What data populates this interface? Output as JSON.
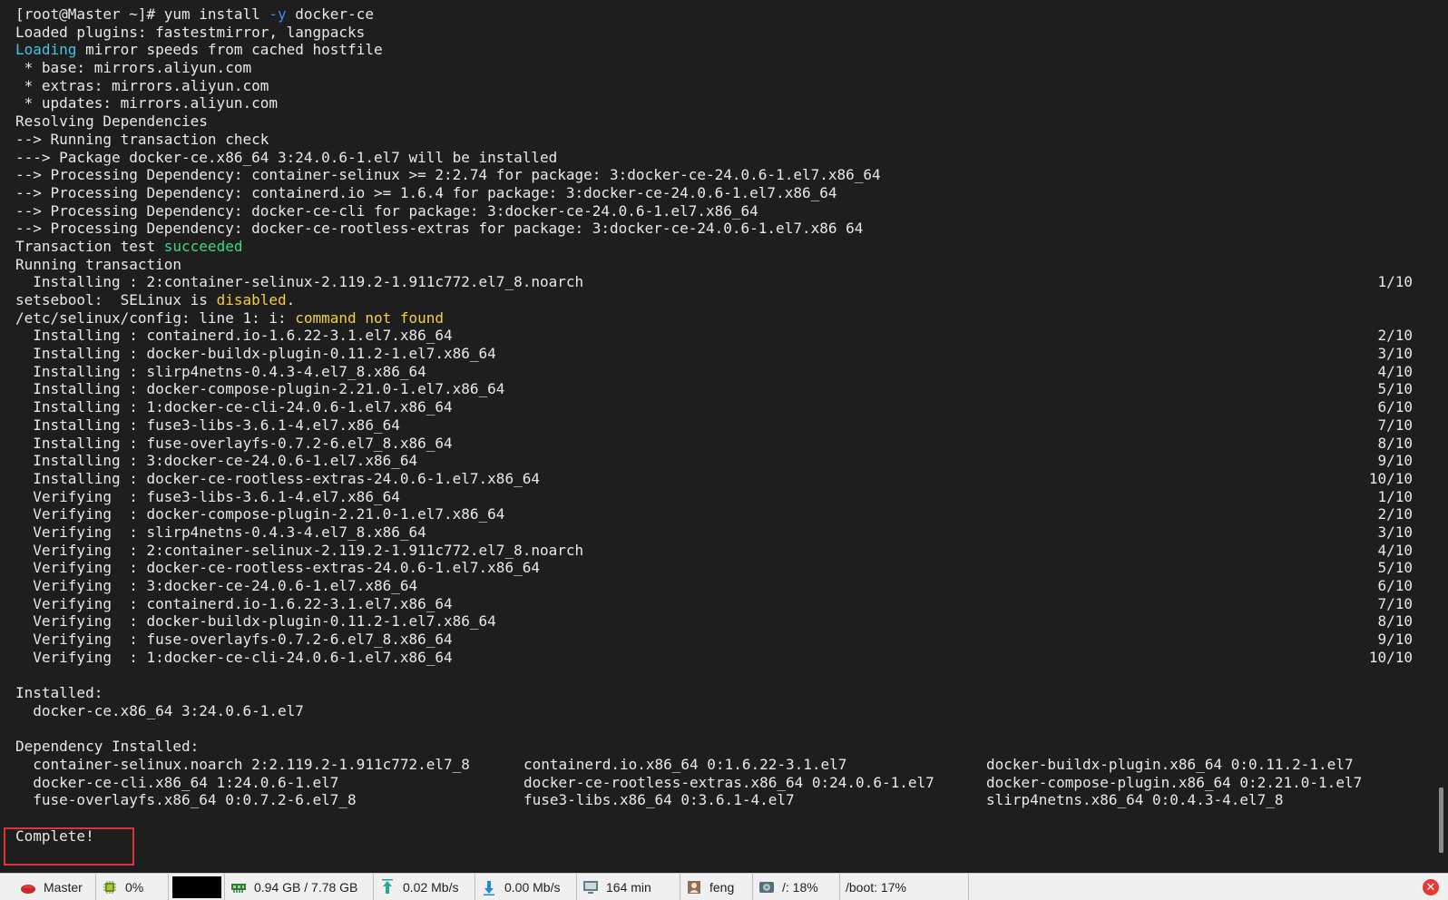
{
  "terminal": {
    "lines": [
      {
        "parts": [
          {
            "t": "[root@Master ~]# yum install "
          },
          {
            "t": "-y",
            "c": "blue"
          },
          {
            "t": " docker-ce"
          }
        ]
      },
      {
        "parts": [
          {
            "t": "Loaded plugins: fastestmirror, langpacks"
          }
        ]
      },
      {
        "parts": [
          {
            "t": "Loading",
            "c": "cyan"
          },
          {
            "t": " mirror speeds from cached hostfile"
          }
        ]
      },
      {
        "parts": [
          {
            "t": " * base: mirrors.aliyun.com"
          }
        ]
      },
      {
        "parts": [
          {
            "t": " * extras: mirrors.aliyun.com"
          }
        ]
      },
      {
        "parts": [
          {
            "t": " * updates: mirrors.aliyun.com"
          }
        ]
      },
      {
        "parts": [
          {
            "t": "Resolving Dependencies"
          }
        ]
      },
      {
        "parts": [
          {
            "t": "--> Running transaction check"
          }
        ]
      },
      {
        "parts": [
          {
            "t": "---> Package docker-ce.x86_64 3:24.0.6-1.el7 will be installed"
          }
        ]
      },
      {
        "parts": [
          {
            "t": "--> Processing Dependency: container-selinux >= 2:2.74 for package: 3:docker-ce-24.0.6-1.el7.x86_64"
          }
        ]
      },
      {
        "parts": [
          {
            "t": "--> Processing Dependency: containerd.io >= 1.6.4 for package: 3:docker-ce-24.0.6-1.el7.x86_64"
          }
        ]
      },
      {
        "parts": [
          {
            "t": "--> Processing Dependency: docker-ce-cli for package: 3:docker-ce-24.0.6-1.el7.x86_64"
          }
        ]
      },
      {
        "parts": [
          {
            "t": "--> Processing Dependency: docker-ce-rootless-extras for package: 3:docker-ce-24.0.6-1.el7.x86 64"
          }
        ]
      },
      {
        "parts": [
          {
            "t": "Transaction test "
          },
          {
            "t": "succeeded",
            "c": "green"
          }
        ]
      },
      {
        "parts": [
          {
            "t": "Running transaction"
          }
        ]
      },
      {
        "parts": [
          {
            "t": "  Installing : 2:container-selinux-2.119.2-1.911c772.el7_8.noarch"
          }
        ],
        "count": "1/10"
      },
      {
        "parts": [
          {
            "t": "setsebool:  SELinux is "
          },
          {
            "t": "disabled",
            "c": "yellow"
          },
          {
            "t": "."
          }
        ]
      },
      {
        "parts": [
          {
            "t": "/etc/selinux/config: line 1: i: "
          },
          {
            "t": "command not found",
            "c": "yellow"
          }
        ]
      },
      {
        "parts": [
          {
            "t": "  Installing : containerd.io-1.6.22-3.1.el7.x86_64"
          }
        ],
        "count": "2/10"
      },
      {
        "parts": [
          {
            "t": "  Installing : docker-buildx-plugin-0.11.2-1.el7.x86_64"
          }
        ],
        "count": "3/10"
      },
      {
        "parts": [
          {
            "t": "  Installing : slirp4netns-0.4.3-4.el7_8.x86_64"
          }
        ],
        "count": "4/10"
      },
      {
        "parts": [
          {
            "t": "  Installing : docker-compose-plugin-2.21.0-1.el7.x86_64"
          }
        ],
        "count": "5/10"
      },
      {
        "parts": [
          {
            "t": "  Installing : 1:docker-ce-cli-24.0.6-1.el7.x86_64"
          }
        ],
        "count": "6/10"
      },
      {
        "parts": [
          {
            "t": "  Installing : fuse3-libs-3.6.1-4.el7.x86_64"
          }
        ],
        "count": "7/10"
      },
      {
        "parts": [
          {
            "t": "  Installing : fuse-overlayfs-0.7.2-6.el7_8.x86_64"
          }
        ],
        "count": "8/10"
      },
      {
        "parts": [
          {
            "t": "  Installing : 3:docker-ce-24.0.6-1.el7.x86_64"
          }
        ],
        "count": "9/10"
      },
      {
        "parts": [
          {
            "t": "  Installing : docker-ce-rootless-extras-24.0.6-1.el7.x86_64"
          }
        ],
        "count": "10/10"
      },
      {
        "parts": [
          {
            "t": "  Verifying  : fuse3-libs-3.6.1-4.el7.x86_64"
          }
        ],
        "count": "1/10"
      },
      {
        "parts": [
          {
            "t": "  Verifying  : docker-compose-plugin-2.21.0-1.el7.x86_64"
          }
        ],
        "count": "2/10"
      },
      {
        "parts": [
          {
            "t": "  Verifying  : slirp4netns-0.4.3-4.el7_8.x86_64"
          }
        ],
        "count": "3/10"
      },
      {
        "parts": [
          {
            "t": "  Verifying  : 2:container-selinux-2.119.2-1.911c772.el7_8.noarch"
          }
        ],
        "count": "4/10"
      },
      {
        "parts": [
          {
            "t": "  Verifying  : docker-ce-rootless-extras-24.0.6-1.el7.x86_64"
          }
        ],
        "count": "5/10"
      },
      {
        "parts": [
          {
            "t": "  Verifying  : 3:docker-ce-24.0.6-1.el7.x86_64"
          }
        ],
        "count": "6/10"
      },
      {
        "parts": [
          {
            "t": "  Verifying  : containerd.io-1.6.22-3.1.el7.x86_64"
          }
        ],
        "count": "7/10"
      },
      {
        "parts": [
          {
            "t": "  Verifying  : docker-buildx-plugin-0.11.2-1.el7.x86_64"
          }
        ],
        "count": "8/10"
      },
      {
        "parts": [
          {
            "t": "  Verifying  : fuse-overlayfs-0.7.2-6.el7_8.x86_64"
          }
        ],
        "count": "9/10"
      },
      {
        "parts": [
          {
            "t": "  Verifying  : 1:docker-ce-cli-24.0.6-1.el7.x86_64"
          }
        ],
        "count": "10/10"
      },
      {
        "parts": [
          {
            "t": ""
          }
        ]
      },
      {
        "parts": [
          {
            "t": "Installed:"
          }
        ]
      },
      {
        "parts": [
          {
            "t": "  docker-ce.x86_64 3:24.0.6-1.el7"
          }
        ]
      },
      {
        "parts": [
          {
            "t": ""
          }
        ]
      },
      {
        "parts": [
          {
            "t": "Dependency Installed:"
          }
        ]
      },
      {
        "cols": [
          "  container-selinux.noarch 2:2.119.2-1.911c772.el7_8",
          "containerd.io.x86_64 0:1.6.22-3.1.el7",
          "docker-buildx-plugin.x86_64 0:0.11.2-1.el7"
        ]
      },
      {
        "cols": [
          "  docker-ce-cli.x86_64 1:24.0.6-1.el7",
          "docker-ce-rootless-extras.x86_64 0:24.0.6-1.el7",
          "docker-compose-plugin.x86_64 0:2.21.0-1.el7"
        ]
      },
      {
        "cols": [
          "  fuse-overlayfs.x86_64 0:0.7.2-6.el7_8",
          "fuse3-libs.x86_64 0:3.6.1-4.el7",
          "slirp4netns.x86_64 0:0.4.3-4.el7_8"
        ]
      },
      {
        "parts": [
          {
            "t": ""
          }
        ]
      },
      {
        "parts": [
          {
            "t": "Complete!"
          }
        ]
      }
    ]
  },
  "statusbar": {
    "host": "Master",
    "cpu": "0%",
    "memory": "0.94 GB / 7.78 GB",
    "upload": "0.02 Mb/s",
    "download": "0.00 Mb/s",
    "uptime": "164 min",
    "user": "feng",
    "root_disk": "/: 18%",
    "boot_disk": "/boot: 17%"
  },
  "icons": {
    "host": "host-icon",
    "cpu": "cpu-icon",
    "memory": "memory-icon",
    "upload": "upload-arrow-icon",
    "download": "download-arrow-icon",
    "uptime": "monitor-icon",
    "user": "user-icon",
    "disk": "disk-icon",
    "close": "close-icon"
  },
  "colors": {
    "terminal_bg": "#1e1e1e",
    "terminal_fg": "#e8e8e8",
    "cyan": "#3fc6e8",
    "green": "#39d98a",
    "yellow": "#f2d13c",
    "highlight": "#e0323c"
  }
}
